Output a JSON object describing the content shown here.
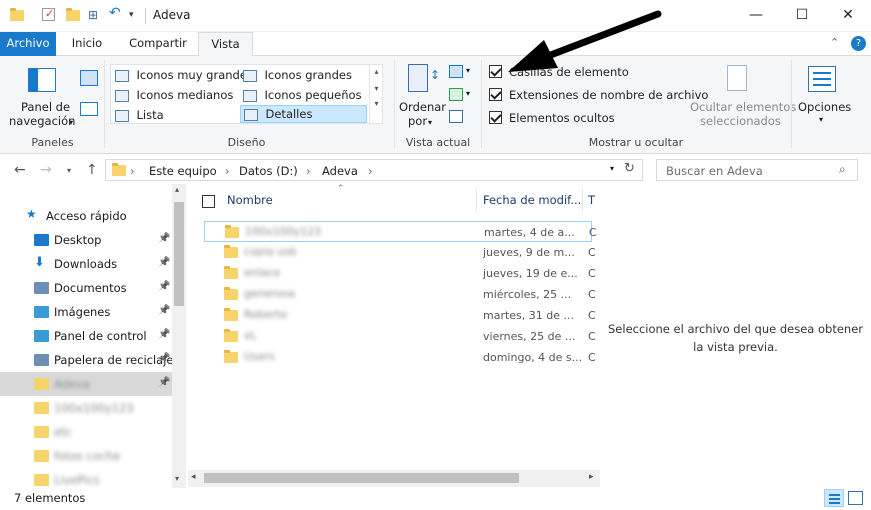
{
  "window": {
    "title": "Adeva",
    "controls": {
      "minimize": "—",
      "maximize": "☐",
      "close": "✕"
    }
  },
  "tabs": [
    "Archivo",
    "Inicio",
    "Compartir",
    "Vista"
  ],
  "ribbon": {
    "paneles": {
      "panel_label_1": "Panel de",
      "panel_label_2": "navegación",
      "group_label": "Paneles"
    },
    "diseno": {
      "options": [
        "Iconos muy grandes",
        "Iconos grandes",
        "Iconos medianos",
        "Iconos pequeños",
        "Lista",
        "Detalles"
      ],
      "selected": "Detalles",
      "group_label": "Diseño"
    },
    "vista_actual": {
      "sort_label_1": "Ordenar",
      "sort_label_2": "por",
      "group_label": "Vista actual"
    },
    "mostrar": {
      "checkboxes": [
        "Casillas de elemento",
        "Extensiones de nombre de archivo",
        "Elementos ocultos"
      ],
      "hide_label_1": "Ocultar elementos",
      "hide_label_2": "seleccionados",
      "group_label": "Mostrar u ocultar"
    },
    "opciones": {
      "label": "Opciones"
    }
  },
  "address": {
    "crumbs": [
      "Este equipo",
      "Datos (D:)",
      "Adeva"
    ],
    "search_placeholder": "Buscar en Adeva"
  },
  "nav": {
    "items": [
      {
        "label": "Acceso rápido",
        "icon": "star-icon",
        "pinned": false
      },
      {
        "label": "Desktop",
        "icon": "desktop-icon",
        "pinned": true
      },
      {
        "label": "Downloads",
        "icon": "download-icon",
        "pinned": true
      },
      {
        "label": "Documentos",
        "icon": "document-icon",
        "pinned": true
      },
      {
        "label": "Imágenes",
        "icon": "image-icon",
        "pinned": true
      },
      {
        "label": "Panel de control",
        "icon": "control-panel-icon",
        "pinned": true
      },
      {
        "label": "Papelera de reciclaje",
        "icon": "recycle-bin-icon",
        "pinned": true
      },
      {
        "label": "Adeva",
        "icon": "folder-icon",
        "pinned": true
      },
      {
        "label": "100x100y123",
        "icon": "folder-icon",
        "pinned": false
      },
      {
        "label": "etc",
        "icon": "folder-icon",
        "pinned": false
      },
      {
        "label": "fotos coche",
        "icon": "folder-icon",
        "pinned": false
      },
      {
        "label": "LivePics",
        "icon": "folder-icon",
        "pinned": false
      }
    ]
  },
  "columns": {
    "name": "Nombre",
    "date": "Fecha de modif...",
    "type": "T"
  },
  "files": [
    {
      "name": "100x100y123",
      "date": "martes, 4 de a...",
      "type": "C"
    },
    {
      "name": "copia usb",
      "date": "jueves, 9 de m...",
      "type": "C"
    },
    {
      "name": "enlace",
      "date": "jueves, 19 de e...",
      "type": "C"
    },
    {
      "name": "generosa",
      "date": "miércoles, 25 ...",
      "type": "C"
    },
    {
      "name": "Roberto",
      "date": "martes, 31 de ...",
      "type": "C"
    },
    {
      "name": "xL",
      "date": "viernes, 25 de ...",
      "type": "C"
    },
    {
      "name": "Users",
      "date": "domingo, 4 de s...",
      "type": "C"
    }
  ],
  "preview": {
    "message": "Seleccione el archivo del que desea obtener la vista previa."
  },
  "status": {
    "count": "7 elementos"
  },
  "colors": {
    "accent": "#1979ca",
    "folder": "#f6d36b",
    "selected": "#cce8ff"
  }
}
